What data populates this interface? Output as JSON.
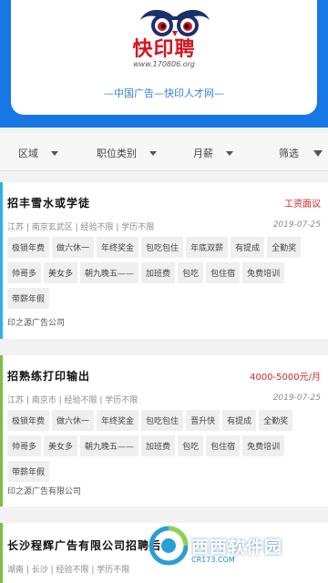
{
  "header": {
    "logo_text": "快印聘",
    "logo_url": "www.170806.org",
    "slogan": "—中国广告—快印人才网—",
    "brand_blue": "#1677e5",
    "brand_red": "#d7141f"
  },
  "filters": [
    {
      "label": "区域"
    },
    {
      "label": "职位类别"
    },
    {
      "label": "月薪"
    },
    {
      "label": "筛选"
    }
  ],
  "jobs": [
    {
      "title": "招丰雪水或学徒",
      "salary": "工资面议",
      "meta": "江苏 | 南京玄武区 | 经验不限 | 学历不限",
      "date": "2019-07-25",
      "tags": [
        "极锁年费",
        "做六休一",
        "年终奖金",
        "包吃包住",
        "年底双薪",
        "有提成",
        "全勤奖",
        "帅哥多",
        "美女多",
        "朝九晚五——",
        "加班费",
        "包吃",
        "包住宿",
        "免费培训",
        "带薪年假"
      ],
      "company": "印之源广告公司",
      "accent": "#2bb3e8"
    },
    {
      "title": "招熟练打印输出",
      "salary": "4000-5000元/月",
      "meta": "江苏 | 南京市 | 经验不限 | 学历不限",
      "date": "2019-07-25",
      "tags": [
        "极锁年费",
        "做六休一",
        "年终奖金",
        "包吃包住",
        "晋升快",
        "有提成",
        "全勤奖",
        "帅哥多",
        "美女多",
        "朝九晚五——",
        "加班费",
        "包吃",
        "包住宿",
        "免费培训",
        "带薪年假"
      ],
      "company": "印之源广告有限公司",
      "accent": "#7ac043"
    },
    {
      "title": "长沙程辉广告有限公司招聘后",
      "salary": "",
      "meta": "湖南 | 长沙 | 经验不限 | 学历不限",
      "date": "",
      "tags": [],
      "company": "",
      "accent": "#7ac043"
    }
  ],
  "watermark": {
    "text": "西西软件园",
    "sub": "CR173.COM"
  }
}
